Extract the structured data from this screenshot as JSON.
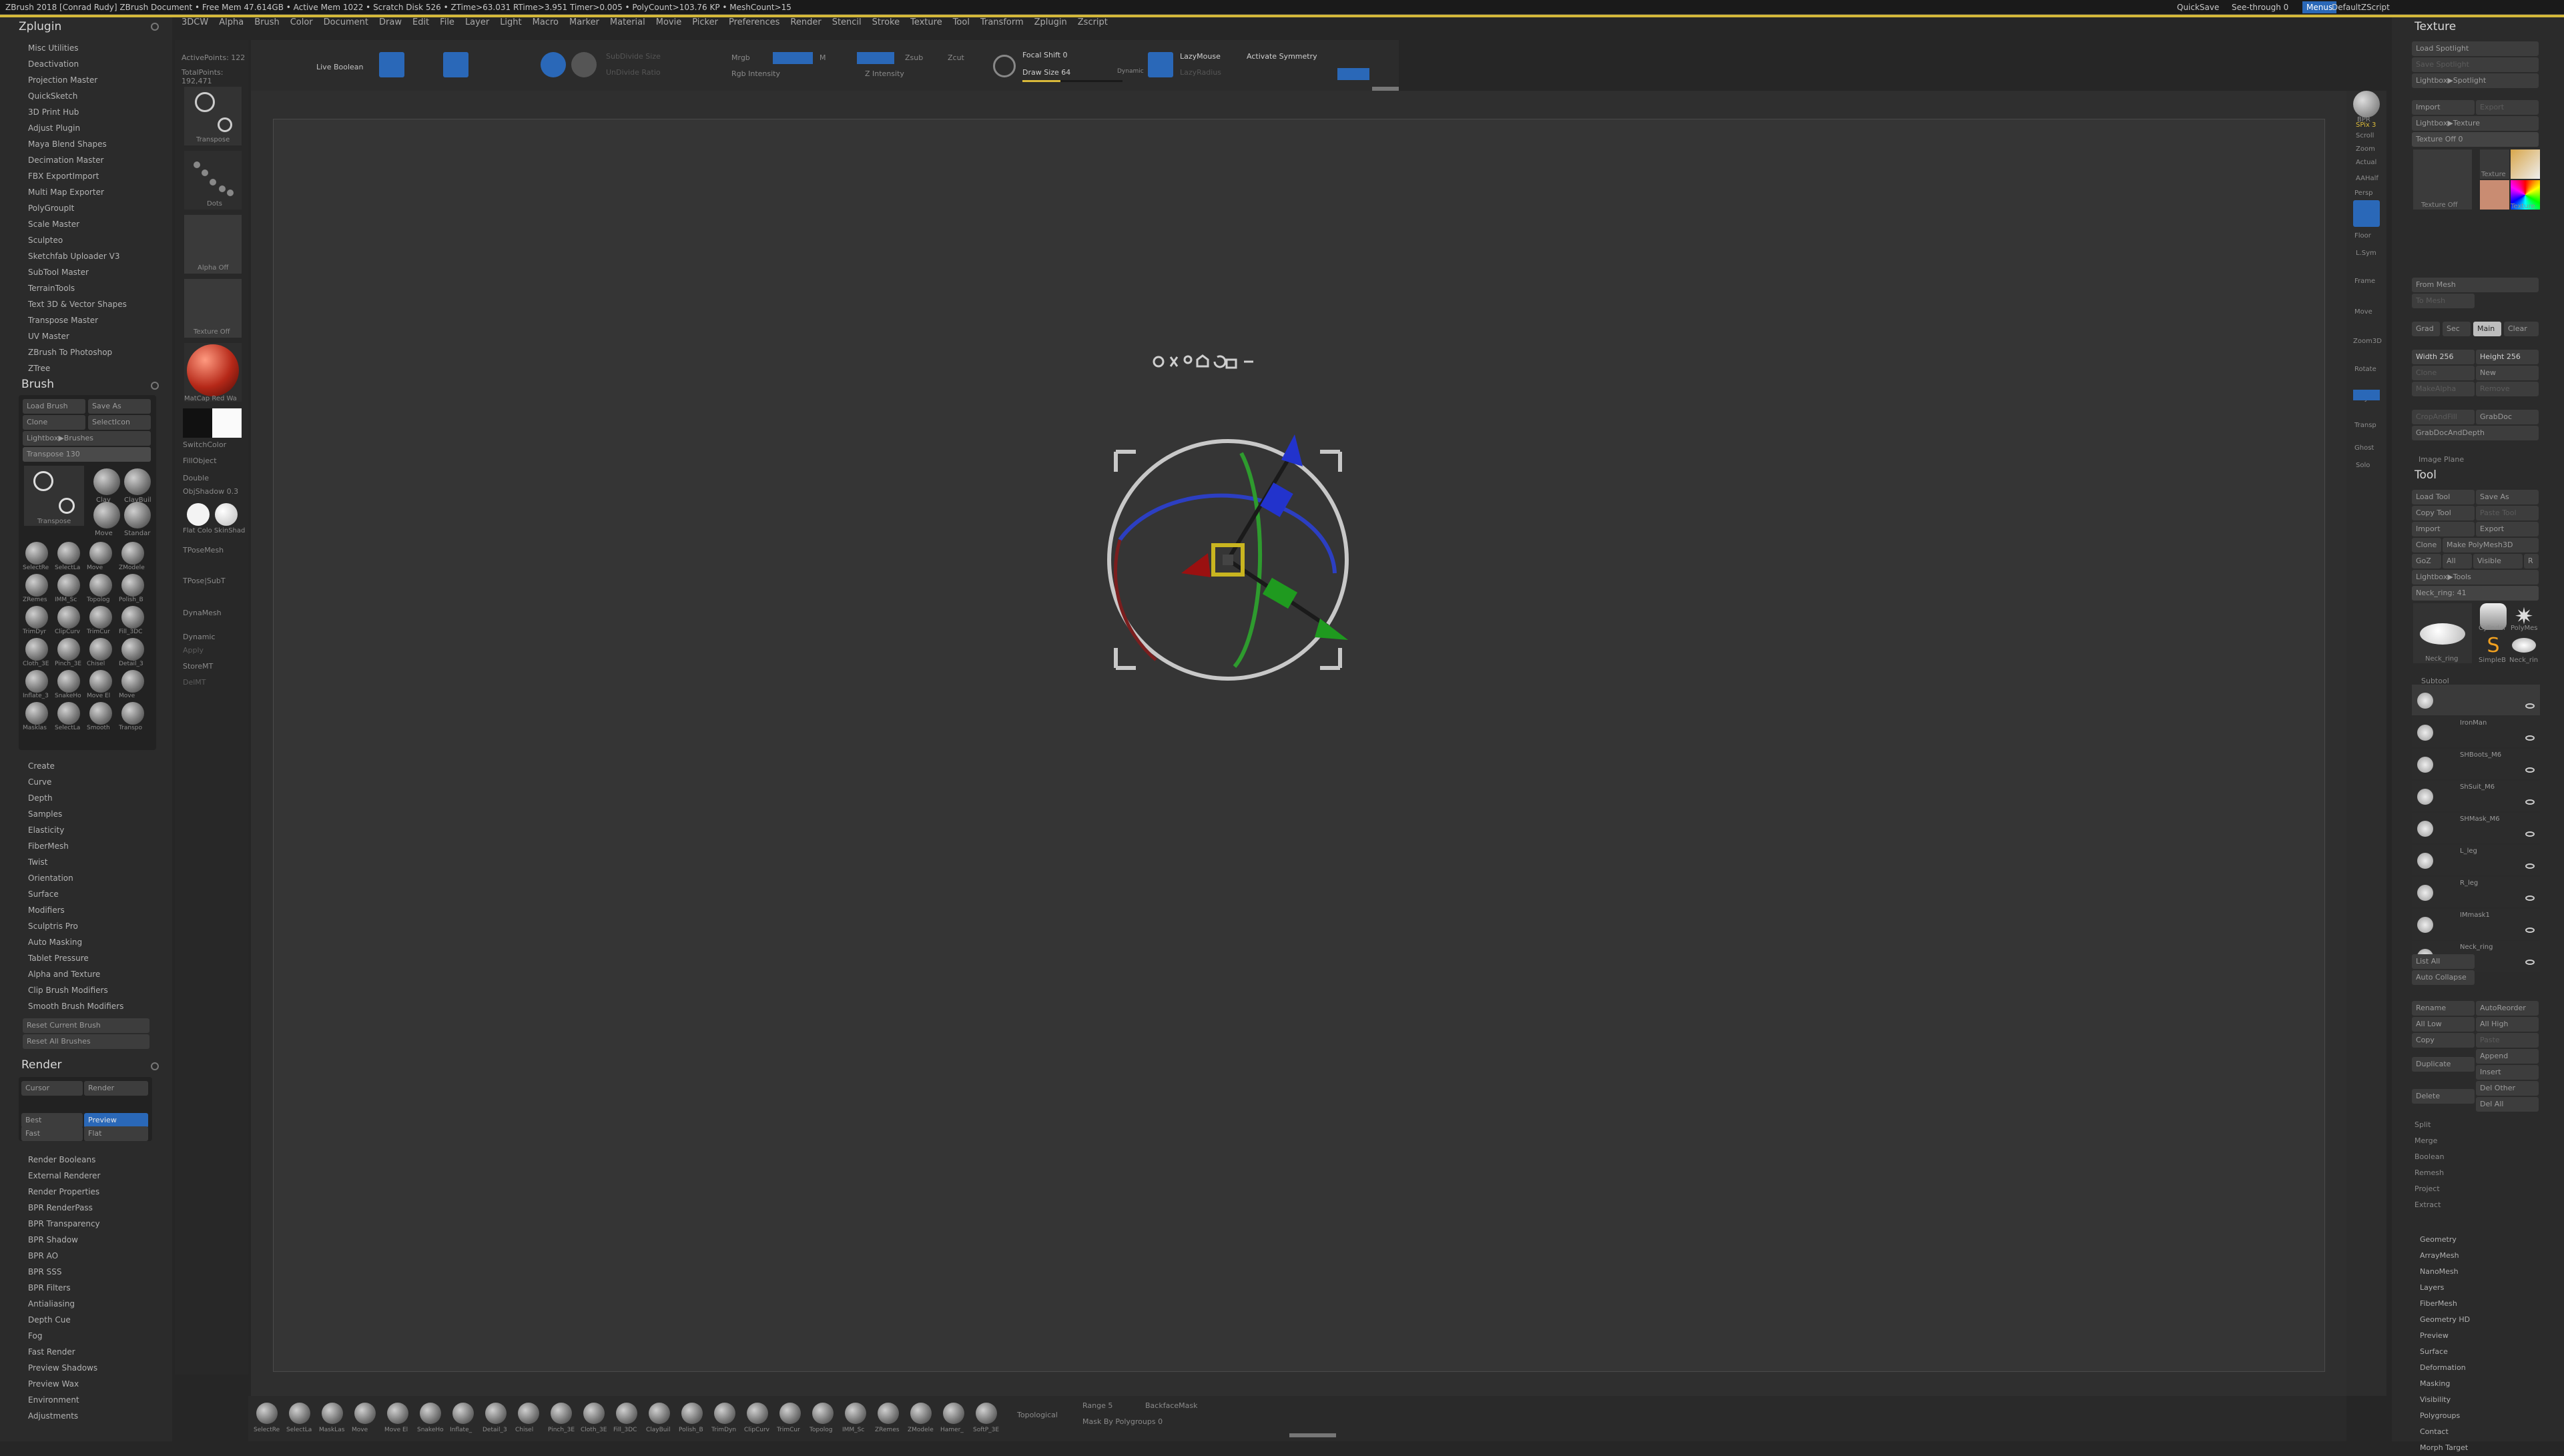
{
  "titlebar": {
    "text": "ZBrush 2018 [Conrad Rudy]   ZBrush Document   • Free Mem 47.614GB • Active Mem 1022 • Scratch Disk 526 • ZTime>63.031 RTime>3.951 Timer>0.005 • PolyCount>103.76 KP • MeshCount>15",
    "quicksave": "QuickSave",
    "seethrough": "See-through  0",
    "menus": "Menus",
    "script": "DefaultZScript"
  },
  "menu": [
    "3DCW",
    "Alpha",
    "Brush",
    "Color",
    "Document",
    "Draw",
    "Edit",
    "File",
    "Layer",
    "Light",
    "Macro",
    "Marker",
    "Material",
    "Movie",
    "Picker",
    "Preferences",
    "Render",
    "Stencil",
    "Stroke",
    "Texture",
    "Tool",
    "Transform",
    "Zplugin",
    "Zscript"
  ],
  "zplugin": {
    "title": "Zplugin",
    "items": [
      "Misc Utilities",
      "Deactivation",
      "Projection Master",
      "QuickSketch",
      "3D Print Hub",
      "Adjust Plugin",
      "Maya Blend Shapes",
      "Decimation Master",
      "FBX ExportImport",
      "Multi Map Exporter",
      "PolyGroupIt",
      "Scale Master",
      "Sculpteo",
      "Sketchfab Uploader V3",
      "SubTool Master",
      "TerrainTools",
      "Text 3D & Vector Shapes",
      "Transpose Master",
      "UV Master",
      "ZBrush To Photoshop",
      "ZTree"
    ]
  },
  "brush": {
    "title": "Brush",
    "load": "Load Brush",
    "save": "Save As",
    "clone": "Clone",
    "selecticon": "SelectIcon",
    "lightbox": "Lightbox▶Brushes",
    "transpose": "Transpose 130",
    "main_label": "Transpose",
    "thumbs": [
      "Clay",
      "ClayBuil",
      "Move",
      "Standar",
      "SelectRe",
      "SelectLa",
      "Move",
      "ZModele",
      "ZRemes",
      "IMM_Sc",
      "Topolog",
      "Polish_B",
      "TrimDyr",
      "ClipCurv",
      "TrimCur",
      "Fill_3DC",
      "Cloth_3E",
      "Pinch_3E",
      "Chisel",
      "Detail_3",
      "Inflate_3",
      "SnakeHo",
      "Move El",
      "Move",
      "Masklas",
      "SelectLa",
      "Smooth",
      "Transpo"
    ],
    "items": [
      "Create",
      "Curve",
      "Depth",
      "Samples",
      "Elasticity",
      "FiberMesh",
      "Twist",
      "Orientation",
      "Surface",
      "Modifiers",
      "Sculptris Pro",
      "Auto Masking",
      "Tablet Pressure",
      "Alpha and Texture",
      "Clip Brush Modifiers",
      "Smooth Brush Modifiers"
    ],
    "reset": "Reset Current Brush",
    "resetall": "Reset All Brushes"
  },
  "render": {
    "title": "Render",
    "cursor": "Cursor",
    "render": "Render",
    "best": "Best",
    "preview": "Preview",
    "fast": "Fast",
    "flat": "Flat",
    "items": [
      "Render Booleans",
      "External Renderer",
      "Render Properties",
      "BPR RenderPass",
      "BPR Transparency",
      "BPR Shadow",
      "BPR AO",
      "BPR SSS",
      "BPR Filters",
      "Antialiasing",
      "Depth Cue",
      "Fog",
      "Fast Render",
      "Preview Shadows",
      "Preview Wax",
      "Environment",
      "Adjustments"
    ]
  },
  "shelf": {
    "active": "ActivePoints: 122",
    "total": "TotalPoints: 192,471",
    "transpose": "Transpose",
    "dots": "Dots",
    "alpha": "Alpha Off",
    "texture": "Texture Off",
    "matcap": "MatCap Red Wa",
    "switch": "SwitchColor",
    "fill": "FillObject",
    "double": "Double",
    "shadow": "ObjShadow 0.3",
    "flat": "Flat Colo SkinShad",
    "tpose": "TPoseMesh",
    "tposesub": "TPose|SubT",
    "dyna": "DynaMesh",
    "dynamic": "Dynamic",
    "apply": "Apply",
    "store": "StoreMT",
    "del": "DelMT"
  },
  "topbar": {
    "liveboolean": "Live Boolean",
    "edit": "Edit",
    "draw": "Draw",
    "move": "Move",
    "scale": "Scale",
    "rotate": "Rotate",
    "mrgb": "Mrgb",
    "rgb": "Rgb",
    "m": "M",
    "zadd": "Zadd",
    "zsub": "Zsub",
    "zcut": "Zcut",
    "subdiv": "SubDivide Size",
    "undo": "UnDivide Ratio",
    "rgbint": "Rgb Intensity",
    "zint": "Z Intensity",
    "focal": "Focal Shift 0",
    "drawsize": "Draw Size 64",
    "dynamic": "Dynamic",
    "lazymouse": "LazyMouse",
    "lazyradius": "LazyRadius",
    "activate": "Activate Symmetry"
  },
  "right_shelf": {
    "bpr": "BPR",
    "spix": "SPix 3",
    "scroll": "Scroll",
    "zoom": "Zoom",
    "actual": "Actual",
    "aahalf": "AAHalf",
    "persp": "Persp",
    "floor": "Floor",
    "lsym": "L.Sym",
    "frame": "Frame",
    "move": "Move",
    "zoom3d": "Zoom3D",
    "rotate": "Rotate",
    "polyf": "PolyF",
    "transp": "Transp",
    "ghost": "Ghost",
    "solo": "Solo",
    "xpose": "Xpose"
  },
  "texture": {
    "title": "Texture",
    "load_spot": "Load Spotlight",
    "save_spot": "Save Spotlight",
    "lightbox_spot": "Lightbox▶Spotlight",
    "import": "Import",
    "export": "Export",
    "lightbox_tex": "Lightbox▶Texture",
    "texoff": "Texture Off  0",
    "labels": [
      "Texture Off",
      "Texture",
      "Texture"
    ],
    "frommesh": "From Mesh",
    "tomesh": "To Mesh",
    "grad": "Grad",
    "sec": "Sec",
    "main": "Main",
    "clear": "Clear",
    "width": "Width 256",
    "height": "Height 256",
    "clone": "Clone",
    "new": "New",
    "makealpha": "MakeAlpha",
    "remove": "Remove",
    "cropfill": "CropAndFill",
    "grabdoc": "GrabDoc",
    "grabdocdepth": "GrabDocAndDepth",
    "imageplane": "Image Plane"
  },
  "tool": {
    "title": "Tool",
    "load": "Load Tool",
    "saveas": "Save As",
    "copy": "Copy Tool",
    "paste": "Paste Tool",
    "import": "Import",
    "export": "Export",
    "clone": "Clone",
    "makepoly": "Make PolyMesh3D",
    "goz": "GoZ",
    "all": "All",
    "visible": "Visible",
    "r": "R",
    "lightbox": "Lightbox▶Tools",
    "neck": "Neck_ring: 41",
    "thumbs": [
      "Neck_ring",
      "Cylinder",
      "PolyMes",
      "SimpleB",
      "Neck_rin"
    ],
    "subtool": "Subtool",
    "subtools": [
      "",
      "IronMan",
      "SHBoots_M6",
      "ShSuit_M6",
      "SHMask_M6",
      "L_leg",
      "R_leg",
      "IMmask1",
      "Neck_ring"
    ],
    "listall": "List All",
    "autocollapse": "Auto Collapse",
    "rename": "Rename",
    "autoreorder": "AutoReorder",
    "alllow": "All Low",
    "allhigh": "All High",
    "copy2": "Copy",
    "paste2": "Paste",
    "duplicate": "Duplicate",
    "append": "Append",
    "insert": "Insert",
    "delete": "Delete",
    "delother": "Del Other",
    "delall": "Del All",
    "actions": [
      "Split",
      "Merge",
      "Boolean",
      "Remesh",
      "Project",
      "Extract"
    ],
    "sections": [
      "Geometry",
      "ArrayMesh",
      "NanoMesh",
      "Layers",
      "FiberMesh",
      "Geometry HD",
      "Preview",
      "Surface",
      "Deformation",
      "Masking",
      "Visibility",
      "Polygroups",
      "Contact",
      "Morph Target"
    ]
  },
  "bottom": {
    "labels": [
      "SelectRe",
      "SelectLa",
      "MaskLas",
      "Move",
      "Move El",
      "SnakeHo",
      "Inflate_",
      "Detail_3",
      "Chisel",
      "Pinch_3E",
      "Cloth_3E",
      "Fill_3DC",
      "ClayBuil",
      "Polish_B",
      "TrimDyn",
      "ClipCurv",
      "TrimCur",
      "Topolog",
      "IMM_Sc",
      "ZRemes",
      "ZModele",
      "Hamer_",
      "SoftP_3E"
    ],
    "topological": "Topological",
    "range": "Range 5",
    "backface": "BackfaceMask",
    "maskpoly": "Mask By Polygroups 0"
  }
}
